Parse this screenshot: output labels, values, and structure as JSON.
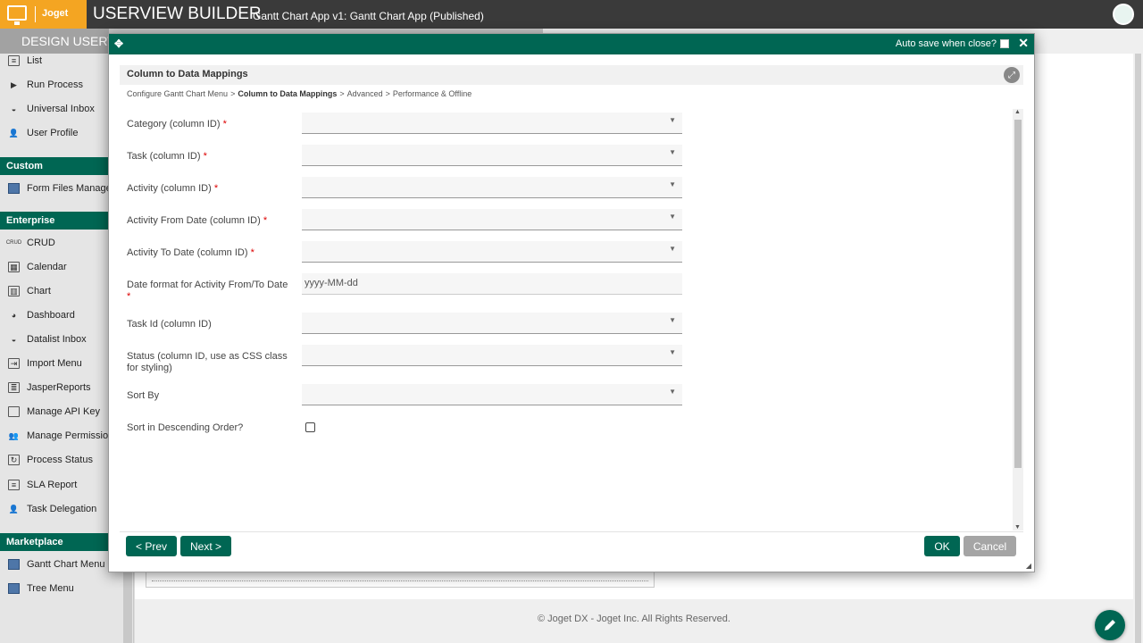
{
  "topbar": {
    "logo_text": "Joget",
    "title": "USERVIEW BUILDER",
    "subtitle": "Gantt Chart App v1: Gantt Chart App (Published)"
  },
  "designbar": {
    "tab_label": "DESIGN USERVIEW"
  },
  "sidebar": {
    "items_top": [
      {
        "label": "List",
        "icon": "list-icon"
      },
      {
        "label": "Run Process",
        "icon": "play-icon"
      },
      {
        "label": "Universal Inbox",
        "icon": "inbox-icon"
      },
      {
        "label": "User Profile",
        "icon": "user-icon"
      }
    ],
    "custom_header": "Custom",
    "custom_items": [
      {
        "label": "Form Files Manager",
        "icon": "plugin-tile-icon"
      }
    ],
    "enterprise_header": "Enterprise",
    "enterprise_items": [
      {
        "label": "CRUD",
        "icon": "crud-icon"
      },
      {
        "label": "Calendar",
        "icon": "calendar-icon"
      },
      {
        "label": "Chart",
        "icon": "chart-icon"
      },
      {
        "label": "Dashboard",
        "icon": "dashboard-icon"
      },
      {
        "label": "Datalist Inbox",
        "icon": "inbox-icon"
      },
      {
        "label": "Import Menu",
        "icon": "import-icon"
      },
      {
        "label": "JasperReports",
        "icon": "report-icon"
      },
      {
        "label": "Manage API Key",
        "icon": "monitor-icon"
      },
      {
        "label": "Manage Permission",
        "icon": "users-icon"
      },
      {
        "label": "Process Status",
        "icon": "status-icon"
      },
      {
        "label": "SLA Report",
        "icon": "list-icon"
      },
      {
        "label": "Task Delegation",
        "icon": "user-gear-icon"
      }
    ],
    "marketplace_header": "Marketplace",
    "marketplace_items": [
      {
        "label": "Gantt Chart Menu",
        "icon": "plugin-tile-icon"
      },
      {
        "label": "Tree Menu",
        "icon": "plugin-tile-icon"
      }
    ]
  },
  "dialog": {
    "autosave_label": "Auto save when close?",
    "autosave_checked": false,
    "title": "Column to Data Mappings",
    "breadcrumb": [
      "Configure Gantt Chart Menu",
      "Column to Data Mappings",
      "Advanced",
      "Performance & Offline"
    ],
    "breadcrumb_current_index": 1,
    "breadcrumb_separator": ">",
    "fields": [
      {
        "label": "Category (column ID)",
        "required": "*",
        "type": "select",
        "value": ""
      },
      {
        "label": "Task (column ID)",
        "required": "*",
        "type": "select",
        "value": ""
      },
      {
        "label": "Activity (column ID)",
        "required": "*",
        "type": "select",
        "value": ""
      },
      {
        "label": "Activity From Date (column ID)",
        "required": "*",
        "type": "select",
        "value": ""
      },
      {
        "label": "Activity To Date (column ID)",
        "required": "*",
        "type": "select",
        "value": ""
      },
      {
        "label": "Date format for Activity From/To Date",
        "required": "*",
        "type": "text",
        "value": "yyyy-MM-dd"
      },
      {
        "label": "Task Id (column ID)",
        "required": "",
        "type": "select",
        "value": ""
      },
      {
        "label": "Status (column ID, use as CSS class for styling)",
        "required": "",
        "type": "select",
        "value": ""
      },
      {
        "label": "Sort By",
        "required": "",
        "type": "select",
        "value": ""
      },
      {
        "label": "Sort in Descending Order?",
        "required": "",
        "type": "checkbox",
        "value": false
      }
    ],
    "buttons": {
      "prev": "< Prev",
      "next": "Next >",
      "ok": "OK",
      "cancel": "Cancel"
    }
  },
  "footer": {
    "copyright": "© Joget DX - Joget Inc. All Rights Reserved."
  },
  "colors": {
    "brand_green": "#006653",
    "logo_orange": "#f4a522",
    "topbar_dark": "#3a3a3a",
    "required_red": "#dd0000"
  }
}
